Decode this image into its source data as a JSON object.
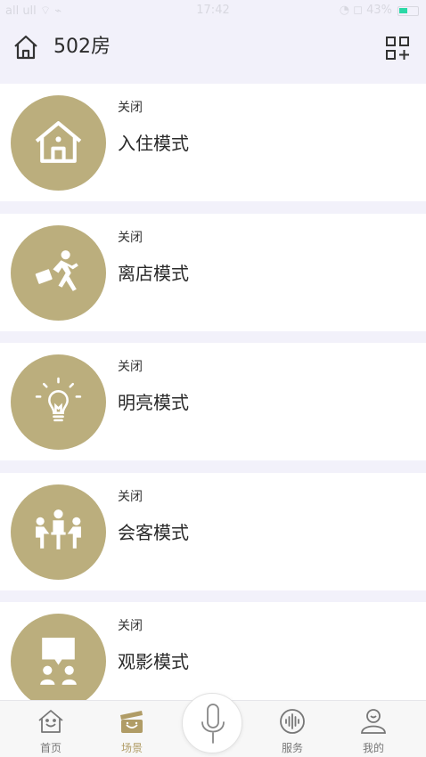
{
  "status_bar": {
    "left": "all ull ⌔ ⌁",
    "time": "17:42",
    "right": "◔ ◻ 43%"
  },
  "header": {
    "title": "502房",
    "home_icon": "home-icon",
    "add_icon": "grid-add-icon"
  },
  "colors": {
    "accent": "#bbae7d",
    "background": "#f2f1fa",
    "tab_active": "#b09c66"
  },
  "scenes": [
    {
      "state": "关闭",
      "name": "入住模式",
      "icon": "house-icon"
    },
    {
      "state": "关闭",
      "name": "离店模式",
      "icon": "running-person-icon"
    },
    {
      "state": "关闭",
      "name": "明亮模式",
      "icon": "light-bulb-icon"
    },
    {
      "state": "关闭",
      "name": "会客模式",
      "icon": "meeting-icon"
    },
    {
      "state": "关闭",
      "name": "观影模式",
      "icon": "presentation-icon"
    }
  ],
  "tabs": [
    {
      "label": "首页",
      "icon": "home-smile-icon",
      "active": false
    },
    {
      "label": "场景",
      "icon": "clapperboard-icon",
      "active": true
    },
    {
      "label": "服务",
      "icon": "voice-wave-icon",
      "active": false
    },
    {
      "label": "我的",
      "icon": "user-icon",
      "active": false
    }
  ],
  "mic_icon": "microphone-icon"
}
